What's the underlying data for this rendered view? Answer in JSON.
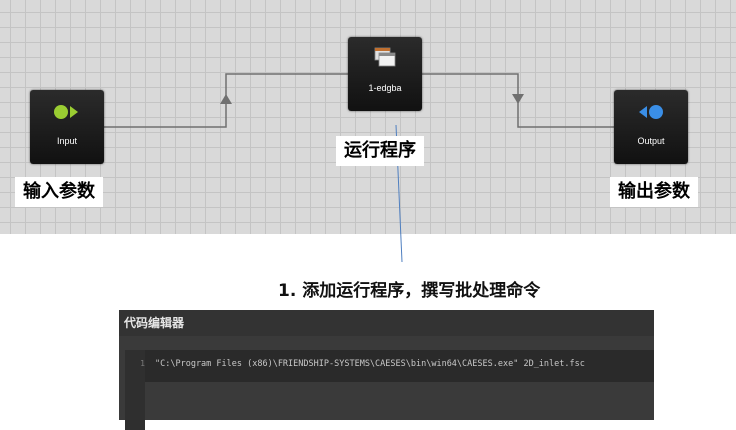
{
  "workflow": {
    "nodes": {
      "input": {
        "label": "Input",
        "icon": "input-arrow-icon",
        "color": "#9acd32"
      },
      "program": {
        "label": "1-edgba",
        "icon": "program-windows-icon"
      },
      "output": {
        "label": "Output",
        "icon": "output-arrow-icon",
        "color": "#3a8ee6"
      }
    }
  },
  "annotations": {
    "input_params": "输入参数",
    "run_program": "运行程序",
    "output_params": "输出参数",
    "step": "1. 添加运行程序，撰写批处理命令"
  },
  "editor": {
    "title": "代码编辑器",
    "lines": [
      {
        "number": "1",
        "text": "\"C:\\Program Files (x86)\\FRIENDSHIP-SYSTEMS\\CAESES\\bin\\win64\\CAESES.exe\" 2D_inlet.fsc"
      }
    ]
  }
}
